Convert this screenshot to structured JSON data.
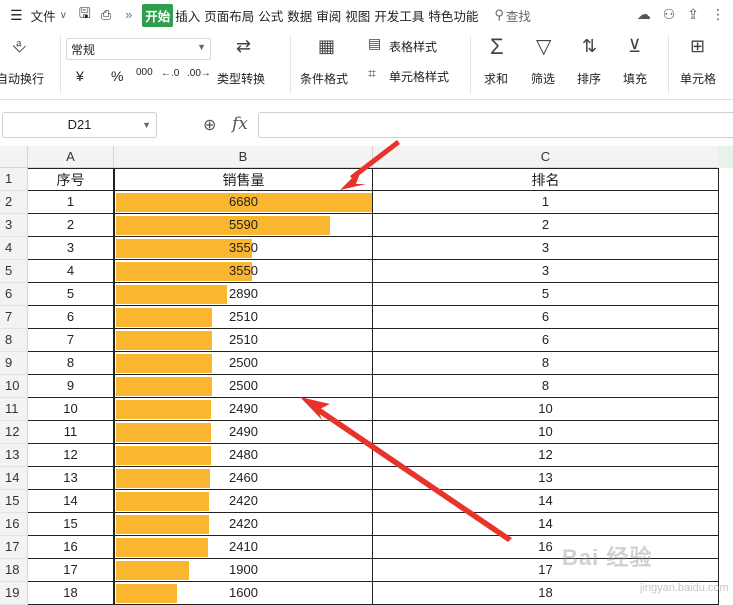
{
  "menubar": {
    "items": [
      "文件",
      "开始",
      "插入",
      "页面布局",
      "公式",
      "数据",
      "审阅",
      "视图",
      "开发工具",
      "特色功能"
    ],
    "active": "开始",
    "search_label": "查找"
  },
  "ribbon": {
    "wrap_label": "自动换行",
    "number_format": "常规",
    "currency_symbol": "¥",
    "percent_symbol": "%",
    "thousands_symbol": "000",
    "dec_increase": "←.0",
    "dec_decrease": ".00→",
    "type_convert": "类型转换",
    "cond_format": "条件格式",
    "table_style": "表格样式",
    "cell_style": "单元格样式",
    "sum": "求和",
    "filter": "筛选",
    "sort": "排序",
    "fill": "填充",
    "cell": "单元格"
  },
  "formulabar": {
    "name_box": "D21",
    "fx": "fx",
    "formula": ""
  },
  "columns": [
    "A",
    "B",
    "C"
  ],
  "header_row": {
    "a": "序号",
    "b": "销售量",
    "c": "排名"
  },
  "rows": [
    {
      "row": "2",
      "a": "1",
      "b": "6680",
      "c": "1"
    },
    {
      "row": "3",
      "a": "2",
      "b": "5590",
      "c": "2"
    },
    {
      "row": "4",
      "a": "3",
      "b": "3550",
      "c": "3"
    },
    {
      "row": "5",
      "a": "4",
      "b": "3550",
      "c": "3"
    },
    {
      "row": "6",
      "a": "5",
      "b": "2890",
      "c": "5"
    },
    {
      "row": "7",
      "a": "6",
      "b": "2510",
      "c": "6"
    },
    {
      "row": "8",
      "a": "7",
      "b": "2510",
      "c": "6"
    },
    {
      "row": "9",
      "a": "8",
      "b": "2500",
      "c": "8"
    },
    {
      "row": "10",
      "a": "9",
      "b": "2500",
      "c": "8"
    },
    {
      "row": "11",
      "a": "10",
      "b": "2490",
      "c": "10"
    },
    {
      "row": "12",
      "a": "11",
      "b": "2490",
      "c": "10"
    },
    {
      "row": "13",
      "a": "12",
      "b": "2480",
      "c": "12"
    },
    {
      "row": "14",
      "a": "13",
      "b": "2460",
      "c": "13"
    },
    {
      "row": "15",
      "a": "14",
      "b": "2420",
      "c": "14"
    },
    {
      "row": "16",
      "a": "15",
      "b": "2420",
      "c": "14"
    },
    {
      "row": "17",
      "a": "16",
      "b": "2410",
      "c": "16"
    },
    {
      "row": "18",
      "a": "17",
      "b": "1900",
      "c": "17"
    },
    {
      "row": "19",
      "a": "18",
      "b": "1600",
      "c": "18"
    }
  ],
  "bar_max": 6680,
  "colors": {
    "bar": "#fbb630",
    "accent": "#2e9f4c",
    "arrow": "#e8332a"
  },
  "watermark": {
    "brand": "Bai 经验",
    "url": "jingyan.baidu.com"
  }
}
